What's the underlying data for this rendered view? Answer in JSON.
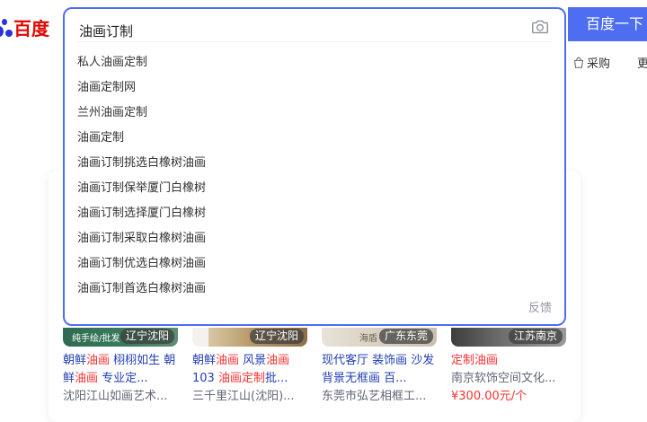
{
  "logo": {
    "brand": "百度"
  },
  "search": {
    "query": "油画订制",
    "suggestions": [
      "私人油画定制",
      "油画定制网",
      "兰州油画定制",
      "油画定制",
      "油画订制挑选白橡树油画",
      "油画订制保举厦门白橡树",
      "油画订制选择厦门白橡树",
      "油画订制采取白橡树油画",
      "油画订制优选白橡树油画",
      "油画订制首选白橡树油画"
    ],
    "feedback": "反馈",
    "button_label": "百度一下"
  },
  "nav": {
    "purchase": "采购",
    "more": "更"
  },
  "products": [
    {
      "tag": "纯手绘/批发",
      "location": "辽宁沈阳",
      "title_parts": [
        [
          "朝鲜",
          ""
        ],
        [
          "油画",
          "hl"
        ],
        [
          " 栩栩如生 朝鲜",
          ""
        ],
        [
          "油画",
          "hl"
        ],
        [
          " 专业定...",
          ""
        ]
      ],
      "shop": "沈阳江山如画艺术...",
      "price": ""
    },
    {
      "tag": "",
      "location": "辽宁沈阳",
      "title_parts": [
        [
          "朝鲜",
          ""
        ],
        [
          "油画",
          "hl"
        ],
        [
          " 风景",
          ""
        ],
        [
          "油画",
          "hl"
        ],
        [
          " 103 ",
          ""
        ],
        [
          "油画定制",
          "hl"
        ],
        [
          "批...",
          ""
        ]
      ],
      "shop": "三千里江山(沈阳)...",
      "price": ""
    },
    {
      "tag": "海盾",
      "location": "广东东莞",
      "title_parts": [
        [
          "现代客厅 装饰画 沙发背景无框画 百...",
          ""
        ]
      ],
      "shop": "东莞市弘艺相框工...",
      "price": ""
    },
    {
      "tag": "",
      "location": "江苏南京",
      "title_parts": [
        [
          "定制",
          "hl"
        ],
        [
          "油画",
          "hl"
        ]
      ],
      "shop": "南京软饰空间文化...",
      "price": "¥300.00元/个"
    }
  ],
  "colors": {
    "accent": "#4e6ef2",
    "brand_red": "#e10601",
    "link": "#2440b3",
    "highlight": "#f73131"
  }
}
